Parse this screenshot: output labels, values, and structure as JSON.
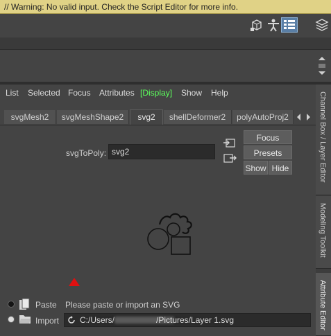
{
  "warning": "// Warning: No valid input. Check the Script Editor for more info.",
  "toolbar_icons": [
    "cube-icon",
    "figure-icon",
    "list-panel-icon",
    "layers-icon"
  ],
  "menu": {
    "list": "List",
    "selected": "Selected",
    "focus": "Focus",
    "attributes": "Attributes",
    "display": "Display",
    "show": "Show",
    "help": "Help"
  },
  "tabs": [
    "svgMesh2",
    "svgMeshShape2",
    "svg2",
    "shellDeformer2",
    "polyAutoProj2"
  ],
  "active_tab": "svg2",
  "attr": {
    "label": "svgToPoly:",
    "value": "svg2"
  },
  "buttons": {
    "focus": "Focus",
    "presets": "Presets",
    "show": "Show",
    "hide": "Hide"
  },
  "side_tabs": [
    "Channel Box / Layer Editor",
    "Modeling Toolkit",
    "Attribute Editor"
  ],
  "paste": {
    "label": "Paste",
    "hint": "Please paste or import an SVG"
  },
  "import": {
    "label": "Import",
    "path_prefix": "C:/Users/",
    "path_suffix": "/Pictures/Layer 1.svg"
  },
  "colors": {
    "warning_bg": "#e0d286",
    "display_green": "#5cff5c",
    "marker_red": "#e01010"
  }
}
